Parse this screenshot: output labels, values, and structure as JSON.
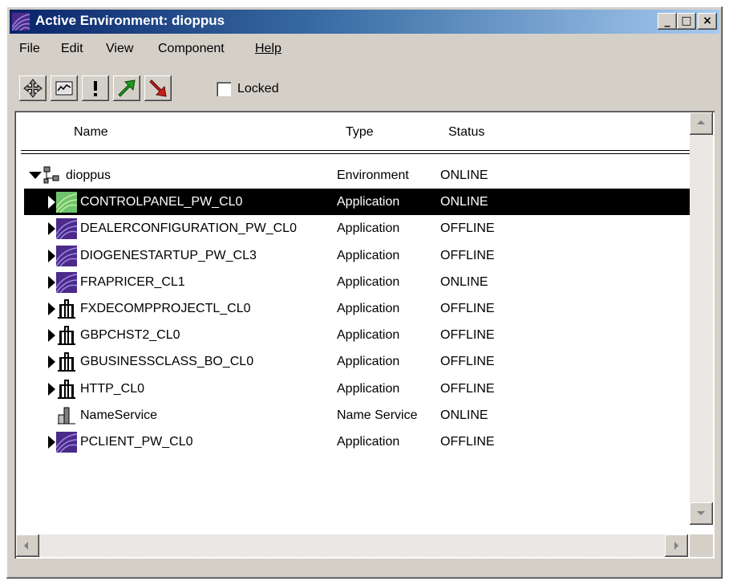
{
  "window": {
    "title": "Active Environment: dioppus",
    "controls": {
      "minimize": "_",
      "maximize": "□",
      "close": "×"
    }
  },
  "menu": [
    {
      "label": "File"
    },
    {
      "label": "Edit"
    },
    {
      "label": "View"
    },
    {
      "label": "Component"
    },
    {
      "label": "Help"
    }
  ],
  "toolbar": {
    "tools": [
      {
        "icon": "move-icon"
      },
      {
        "icon": "chart-icon"
      },
      {
        "icon": "exclamation-icon"
      },
      {
        "icon": "green-up-arrow-icon"
      },
      {
        "icon": "red-down-arrow-icon"
      }
    ],
    "locked_label": "Locked",
    "locked_checked": false
  },
  "columns": {
    "name": "Name",
    "type": "Type",
    "status": "Status"
  },
  "rows": [
    {
      "name": "dioppus",
      "type": "Environment",
      "status": "ONLINE",
      "icon": "environment-icon",
      "expander": "expanded",
      "selected": false
    },
    {
      "name": "CONTROLPANEL_PW_CL0",
      "type": "Application",
      "status": "ONLINE",
      "icon": "green-app-icon",
      "expander": "collapsed",
      "selected": true
    },
    {
      "name": "DEALERCONFIGURATION_PW_CL0",
      "type": "Application",
      "status": "OFFLINE",
      "icon": "purple-app-icon",
      "expander": "collapsed",
      "selected": false
    },
    {
      "name": "DIOGENESTARTUP_PW_CL3",
      "type": "Application",
      "status": "OFFLINE",
      "icon": "purple-app-icon",
      "expander": "collapsed",
      "selected": false
    },
    {
      "name": "FRAPRICER_CL1",
      "type": "Application",
      "status": "ONLINE",
      "icon": "purple-app-icon",
      "expander": "collapsed",
      "selected": false
    },
    {
      "name": "FXDECOMPPROJECTL_CL0",
      "type": "Application",
      "status": "OFFLINE",
      "icon": "building-icon",
      "expander": "collapsed",
      "selected": false
    },
    {
      "name": "GBPCHST2_CL0",
      "type": "Application",
      "status": "OFFLINE",
      "icon": "building-icon",
      "expander": "collapsed",
      "selected": false
    },
    {
      "name": "GBUSINESSCLASS_BO_CL0",
      "type": "Application",
      "status": "OFFLINE",
      "icon": "building-icon",
      "expander": "collapsed",
      "selected": false
    },
    {
      "name": "HTTP_CL0",
      "type": "Application",
      "status": "OFFLINE",
      "icon": "building-icon",
      "expander": "collapsed",
      "selected": false
    },
    {
      "name": "NameService",
      "type": "Name Service",
      "status": "ONLINE",
      "icon": "name-service-icon",
      "expander": "none",
      "selected": false
    },
    {
      "name": "PCLIENT_PW_CL0",
      "type": "Application",
      "status": "OFFLINE",
      "icon": "purple-app-icon",
      "expander": "collapsed",
      "selected": false
    }
  ]
}
